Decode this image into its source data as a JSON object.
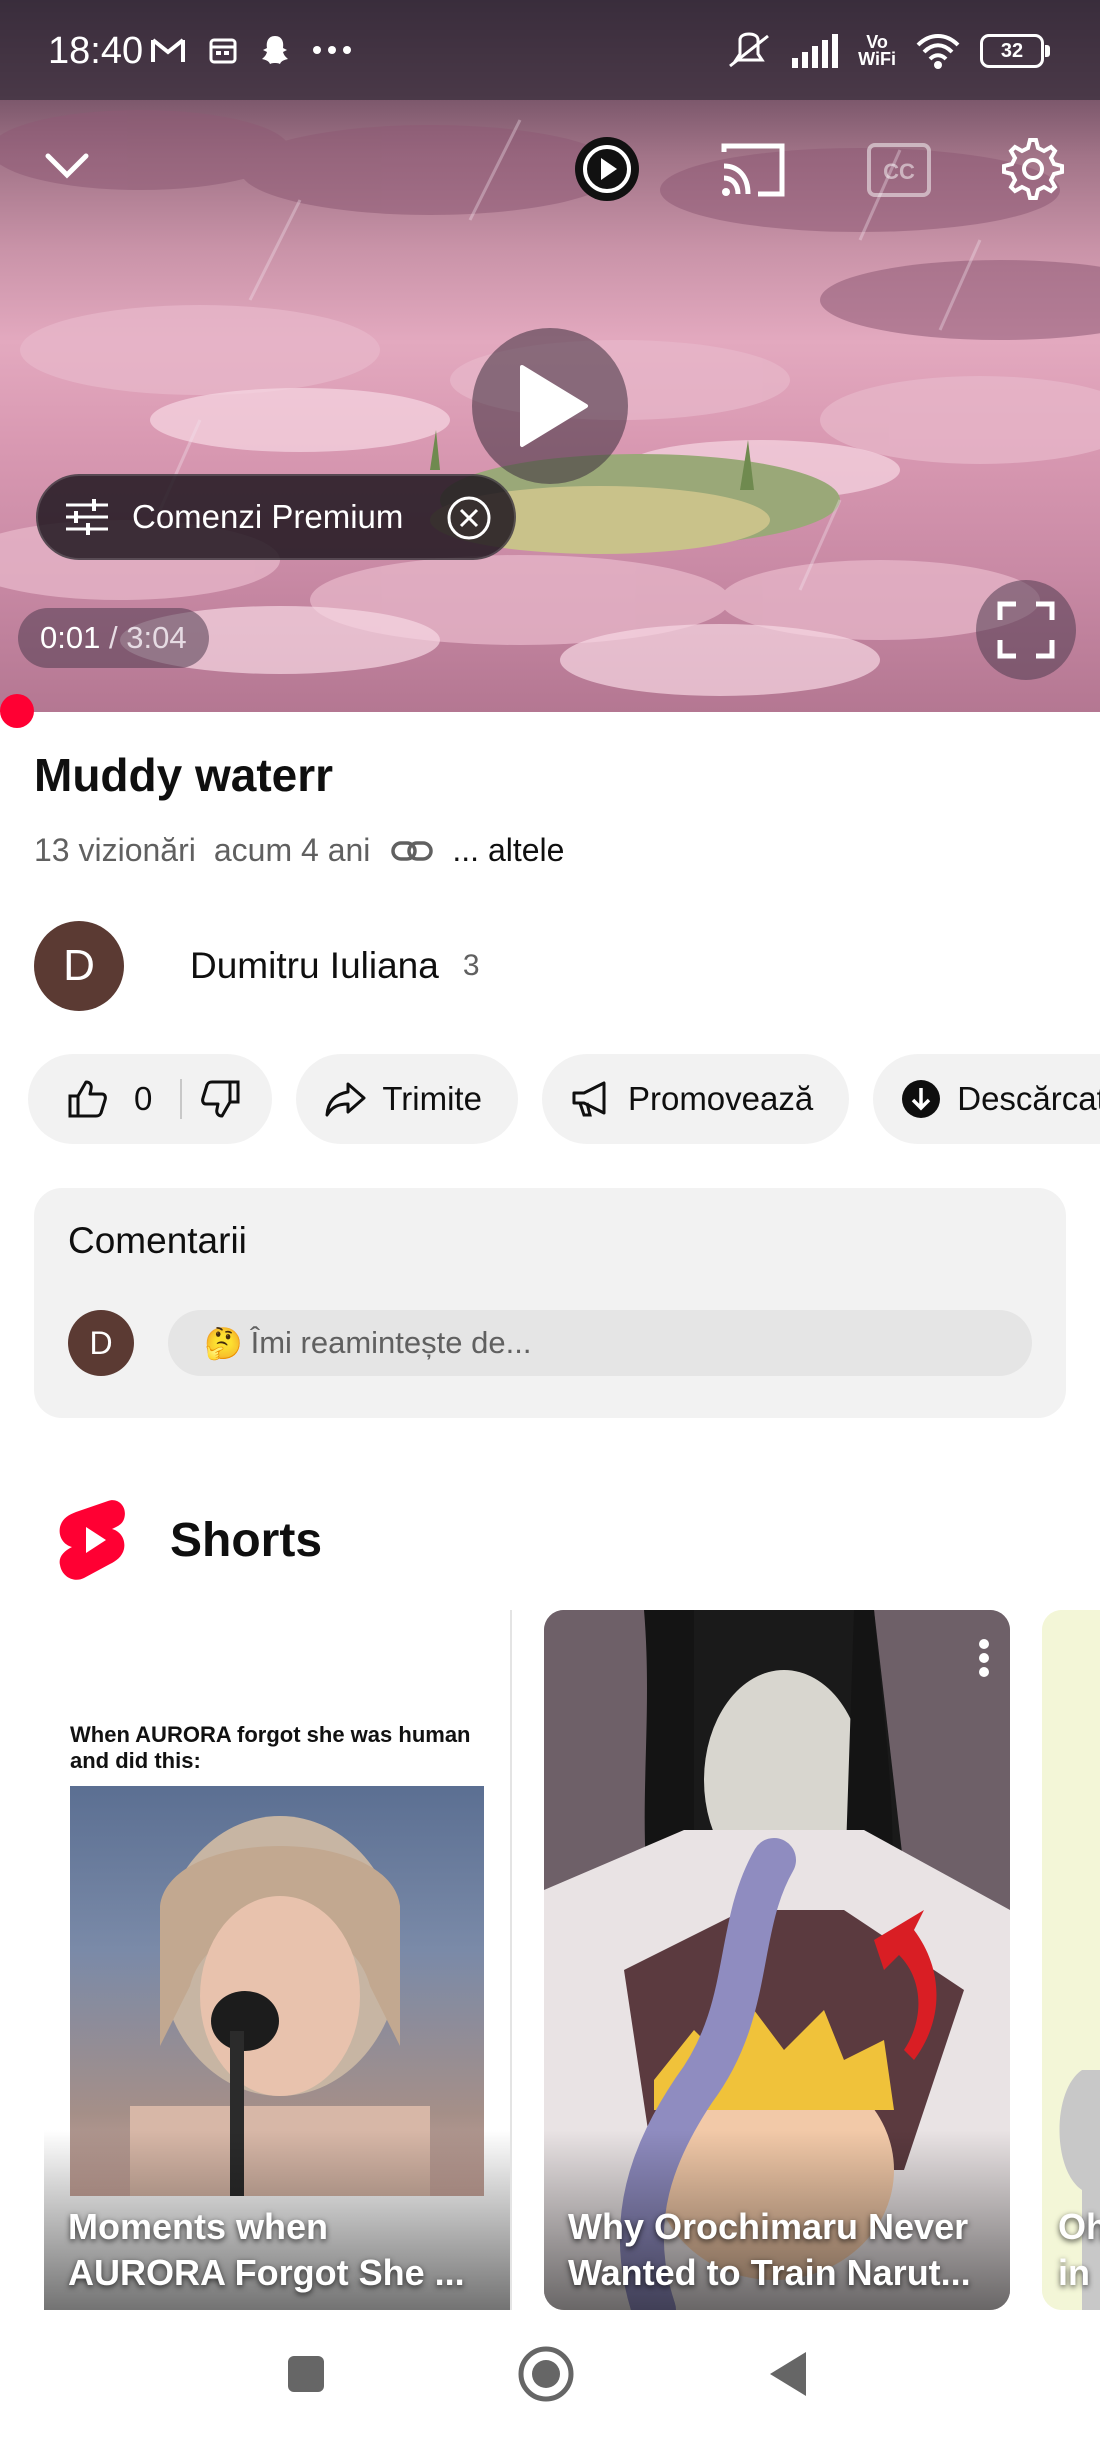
{
  "status_bar": {
    "time": "18:40",
    "left_icons": [
      "gmail-icon",
      "calendar-icon",
      "snapchat-icon",
      "more-dots-icon"
    ],
    "vowifi_top": "Vo",
    "vowifi_bottom": "WiFi",
    "battery": "32"
  },
  "player": {
    "premium_chip_label": "Comenzi Premium",
    "current_time": "0:01",
    "time_separator": "/",
    "duration": "3:04",
    "progress_fraction": 0.005
  },
  "video": {
    "title": "Muddy waterr",
    "views": "13 vizionări",
    "age": "acum 4 ani",
    "more": "... altele"
  },
  "channel": {
    "avatar_letter": "D",
    "name": "Dumitru Iuliana",
    "subscribers": "3"
  },
  "actions": {
    "likes": "0",
    "share": "Trimite",
    "promote": "Promovează",
    "download": "Descărcați"
  },
  "comments": {
    "header": "Comentarii",
    "avatar_letter": "D",
    "placeholder_emoji": "🤔",
    "placeholder": "Îmi reamintește de..."
  },
  "shorts": {
    "header": "Shorts",
    "items": [
      {
        "overlay_text": "When AURORA forgot she was human and did this:",
        "caption": "Moments when AURORA Forgot She ..."
      },
      {
        "caption": "Why Orochimaru Never Wanted to Train Narut..."
      },
      {
        "caption": "Oh in"
      }
    ]
  },
  "colors": {
    "accent_red": "#ff0033",
    "pill_bg": "#f2f2f2",
    "avatar_bg": "#5b3a33"
  }
}
